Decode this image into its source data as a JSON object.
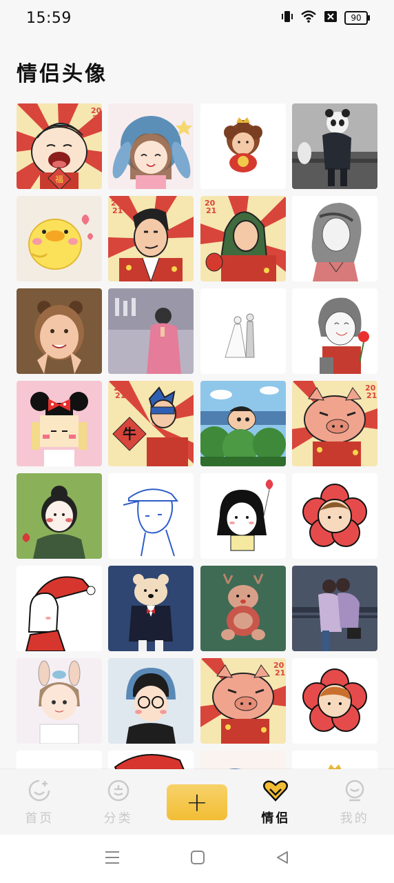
{
  "status_bar": {
    "time": "15:59",
    "battery": "90",
    "icons": [
      "vibrate-icon",
      "wifi-icon",
      "no-sim-icon",
      "battery-icon"
    ]
  },
  "page": {
    "title": "情侣头像"
  },
  "avatars": [
    {
      "name": "avatar-crayon-shinchan-fu-crying",
      "year": "2021"
    },
    {
      "name": "avatar-girl-bunny-hood"
    },
    {
      "name": "avatar-curly-hair-baby"
    },
    {
      "name": "avatar-panda-hat-photo"
    },
    {
      "name": "avatar-yellow-chick"
    },
    {
      "name": "avatar-crayon-man-2021",
      "year": "2021"
    },
    {
      "name": "avatar-crayon-woman-lantern",
      "year": "2021"
    },
    {
      "name": "avatar-sketch-girl"
    },
    {
      "name": "avatar-girl-photo"
    },
    {
      "name": "avatar-girl-kitchen-photo"
    },
    {
      "name": "avatar-wedding-couple-sketch"
    },
    {
      "name": "avatar-boy-flower-sketch"
    },
    {
      "name": "avatar-pixel-minnie-girl"
    },
    {
      "name": "avatar-crayon-action-mask-niu",
      "year": "2021"
    },
    {
      "name": "avatar-shinchan-bush"
    },
    {
      "name": "avatar-buriburi-pig",
      "year": "2021"
    },
    {
      "name": "avatar-girl-green-scarf"
    },
    {
      "name": "avatar-line-boy-cap"
    },
    {
      "name": "avatar-girl-heart-balloon"
    },
    {
      "name": "avatar-boy-flower-frame"
    },
    {
      "name": "avatar-christmas-hat-girl"
    },
    {
      "name": "avatar-bear-suit"
    },
    {
      "name": "avatar-reindeer-bear"
    },
    {
      "name": "avatar-couple-hug-photo"
    },
    {
      "name": "avatar-bunny-ears-boy"
    },
    {
      "name": "avatar-glasses-boy"
    },
    {
      "name": "avatar-buriburi-pig-2",
      "year": "2021"
    },
    {
      "name": "avatar-girl-flower-frame"
    },
    {
      "name": "avatar-partial-1"
    },
    {
      "name": "avatar-partial-santa-hat"
    },
    {
      "name": "avatar-partial-3"
    },
    {
      "name": "avatar-partial-4"
    }
  ],
  "bottom_nav": {
    "items": [
      {
        "label": "首页",
        "icon": "home-smile-icon",
        "active": false
      },
      {
        "label": "分类",
        "icon": "category-face-icon",
        "active": false
      },
      {
        "label": "+",
        "icon": "plus-icon",
        "active": false
      },
      {
        "label": "情侣",
        "icon": "couple-heart-icon",
        "active": true
      },
      {
        "label": "我的",
        "icon": "profile-face-icon",
        "active": false
      }
    ]
  },
  "system_nav": {
    "icons": [
      "menu-icon",
      "home-square-icon",
      "back-triangle-icon"
    ]
  },
  "colors": {
    "accent": "#f2bd34",
    "active_text": "#111111",
    "inactive_text": "#c9c9c9"
  }
}
